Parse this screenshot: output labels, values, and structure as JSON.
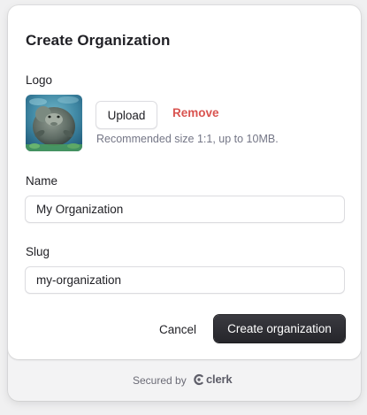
{
  "dialog": {
    "title": "Create Organization",
    "logo": {
      "label": "Logo",
      "upload_label": "Upload",
      "remove_label": "Remove",
      "hint": "Recommended size 1:1, up to 10MB."
    },
    "name": {
      "label": "Name",
      "value": "My Organization"
    },
    "slug": {
      "label": "Slug",
      "value": "my-organization"
    },
    "actions": {
      "cancel_label": "Cancel",
      "create_label": "Create organization"
    },
    "footer": {
      "secured_by": "Secured by",
      "brand": "clerk"
    }
  },
  "colors": {
    "primary_button": "#2f2f35",
    "danger": "#d9534f",
    "muted_text": "#747686"
  }
}
